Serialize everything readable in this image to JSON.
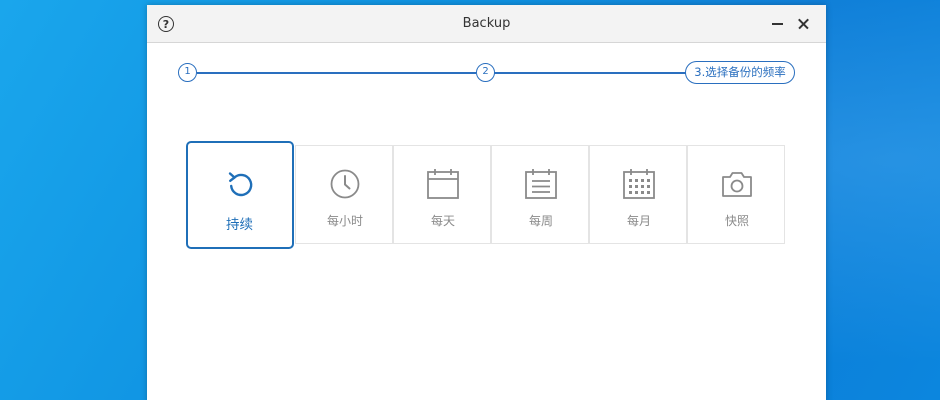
{
  "window": {
    "title": "Backup",
    "help_icon": "?"
  },
  "stepper": {
    "steps": [
      {
        "label": "1"
      },
      {
        "label": "2"
      },
      {
        "label": "3.选择备份的频率"
      }
    ]
  },
  "frequency_options": [
    {
      "label": "持续",
      "icon": "refresh-icon",
      "selected": true
    },
    {
      "label": "每小时",
      "icon": "clock-icon",
      "selected": false
    },
    {
      "label": "每天",
      "icon": "calendar-day-icon",
      "selected": false
    },
    {
      "label": "每周",
      "icon": "calendar-week-icon",
      "selected": false
    },
    {
      "label": "每月",
      "icon": "calendar-month-icon",
      "selected": false
    },
    {
      "label": "快照",
      "icon": "camera-icon",
      "selected": false
    }
  ],
  "colors": {
    "accent": "#1f6fb8",
    "inactive": "#8a8a8a",
    "desktop": "#0d8fe0"
  }
}
